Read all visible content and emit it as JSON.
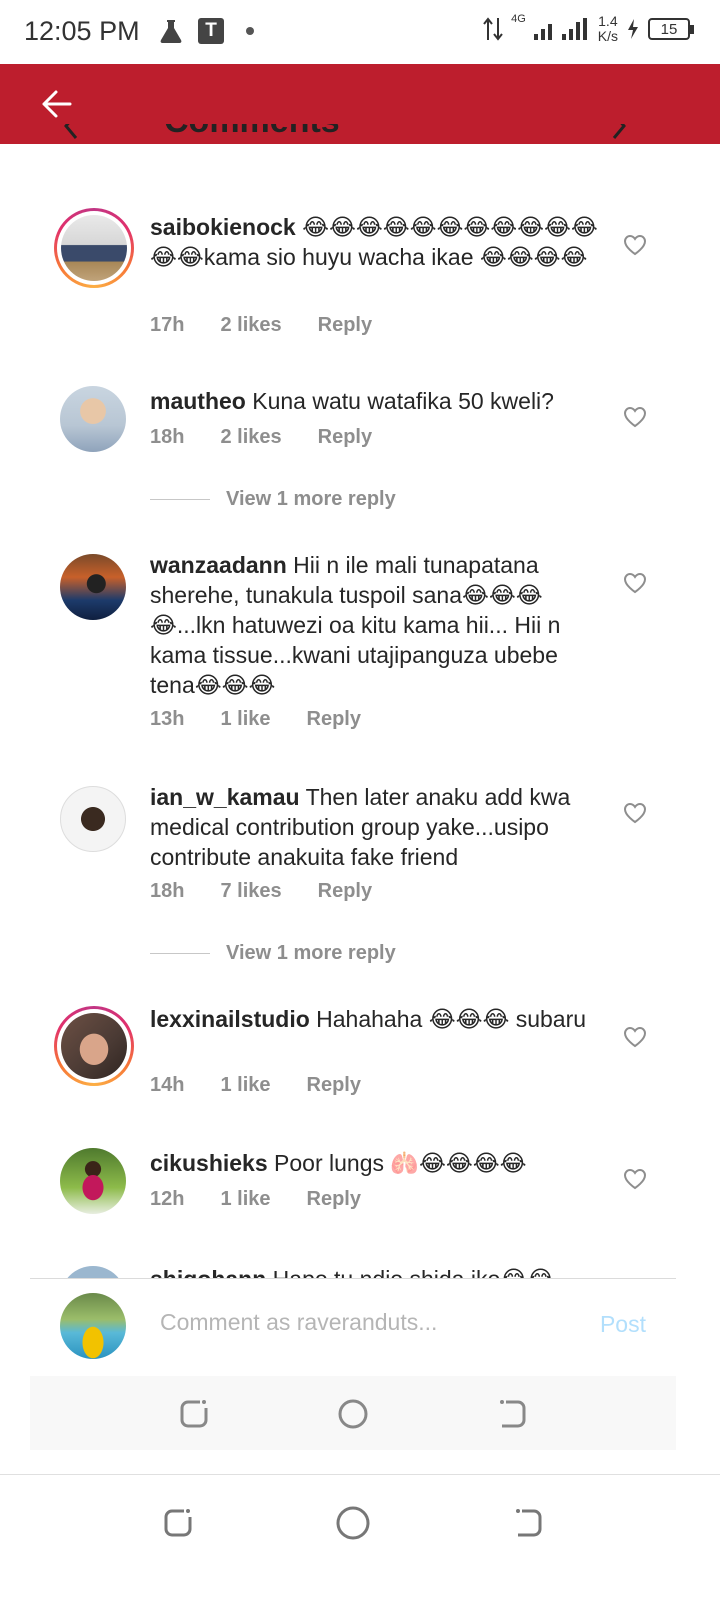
{
  "status_bar": {
    "time": "12:05 PM",
    "t_label": "T",
    "network": "4G",
    "speed_value": "1.4",
    "speed_unit": "K/s",
    "battery": "15"
  },
  "header": {
    "partial_title": "Comments"
  },
  "comments": [
    {
      "username": "saibokienock",
      "text": "😂😂😂😂😂😂😂😂😂😂😂😂😂kama sio huyu wacha ikae 😂😂😂😂",
      "time": "17h",
      "likes": "2 likes",
      "reply": "Reply"
    },
    {
      "username": "mautheo",
      "text": "Kuna watu watafika 50 kweli?",
      "time": "18h",
      "likes": "2 likes",
      "reply": "Reply",
      "view_more": "View 1 more reply"
    },
    {
      "username": "wanzaadann",
      "text": "Hii n ile mali tunapatana sherehe, tunakula tuspoil sana😂😂😂😂...lkn hatuwezi oa kitu kama hii... Hii n kama tissue...kwani utajipanguza ubebe tena😂😂😂",
      "time": "13h",
      "likes": "1 like",
      "reply": "Reply"
    },
    {
      "username": "ian_w_kamau",
      "text": "Then later anaku add kwa medical contribution group yake...usipo contribute anakuita fake friend",
      "time": "18h",
      "likes": "7 likes",
      "reply": "Reply",
      "view_more": "View 1 more reply"
    },
    {
      "username": "lexxinailstudio",
      "text": "Hahahaha 😂😂😂 subaru",
      "time": "14h",
      "likes": "1 like",
      "reply": "Reply"
    },
    {
      "username": "cikushieks",
      "text": "Poor lungs 🫁😂😂😂😂",
      "time": "12h",
      "likes": "1 like",
      "reply": "Reply"
    },
    {
      "username": "shiqohann",
      "text": "Hapo tu ndio shida iko😂😂"
    }
  ],
  "composer": {
    "placeholder": "Comment as raveranduts...",
    "post_label": "Post"
  },
  "colors": {
    "header_red": "#bd1e2d",
    "post_blue_disabled": "#b2dffc"
  }
}
